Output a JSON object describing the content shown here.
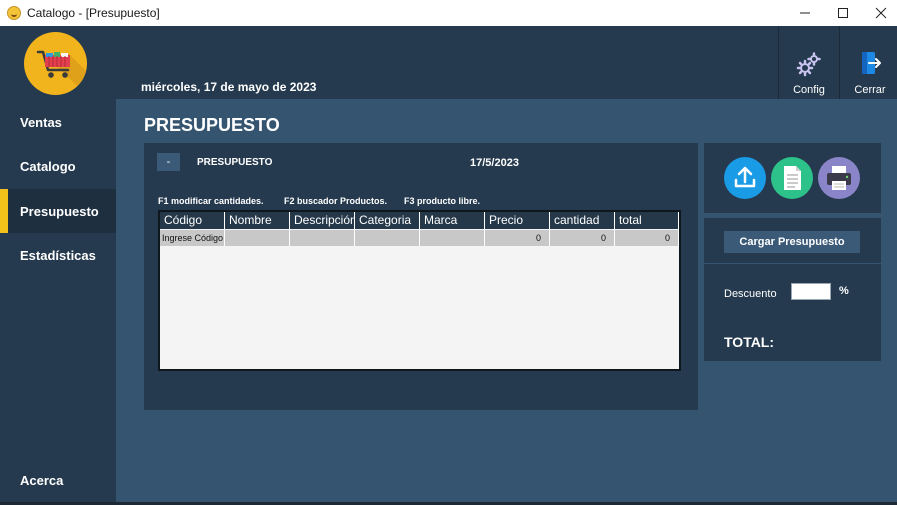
{
  "window": {
    "title": "Catalogo - [Presupuesto]",
    "controls": [
      "minimize",
      "maximize",
      "close"
    ]
  },
  "header": {
    "date": "miércoles, 17 de mayo de 2023",
    "buttons": [
      {
        "label": "Config",
        "icon": "gears-icon"
      },
      {
        "label": "Cerrar",
        "icon": "exit-icon"
      }
    ]
  },
  "sidebar": {
    "items": [
      {
        "label": "Ventas",
        "active": false
      },
      {
        "label": "Catalogo",
        "active": false
      },
      {
        "label": "Presupuesto",
        "active": true
      },
      {
        "label": "Estadísticas",
        "active": false
      }
    ],
    "footer_item": {
      "label": "Acerca"
    }
  },
  "page": {
    "title": "PRESUPUESTO"
  },
  "panel": {
    "minus_label": "-",
    "label": "PRESUPUESTO",
    "date": "17/5/2023",
    "hints": [
      "F1 modificar cantidades.",
      "F2 buscador Productos.",
      "F3 producto libre."
    ]
  },
  "grid": {
    "columns": [
      "Código",
      "Nombre",
      "Descripción",
      "Categoria",
      "Marca",
      "Precio",
      "cantidad",
      "total"
    ],
    "rows": [
      [
        "Ingrese Código",
        "",
        "",
        "",
        "",
        "0",
        "0",
        "0"
      ]
    ]
  },
  "actions": {
    "round_buttons": [
      {
        "name": "upload-button",
        "icon": "upload-icon",
        "color": "#1a9be6"
      },
      {
        "name": "document-button",
        "icon": "document-icon",
        "color": "#2cc28a"
      },
      {
        "name": "print-button",
        "icon": "printer-icon",
        "color": "#8a84c8"
      }
    ],
    "load_label": "Cargar Presupuesto",
    "discount_label": "Descuento",
    "discount_value": "",
    "percent_sign": "%",
    "total_label": "TOTAL:"
  },
  "colors": {
    "background": "#35546f",
    "panel": "#253a4e",
    "accent": "#f2c21b",
    "button": "#3a5a78"
  }
}
